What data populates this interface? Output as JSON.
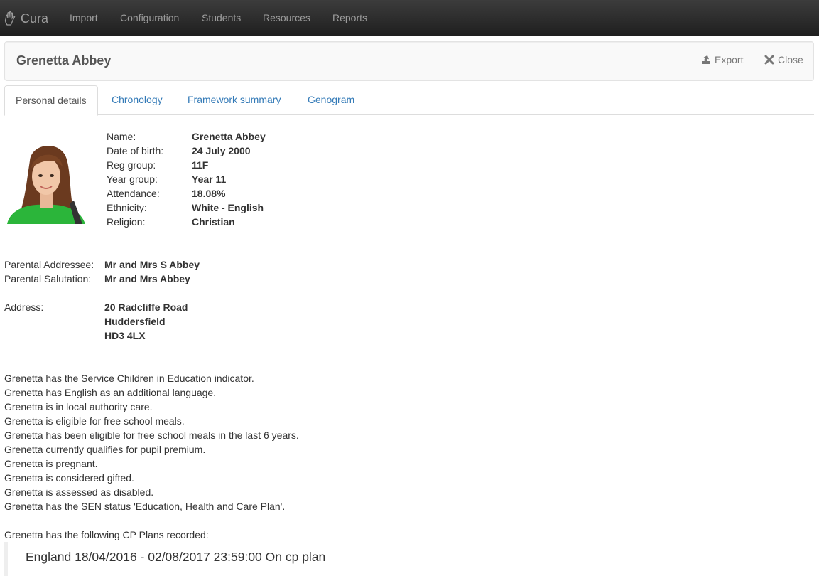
{
  "nav": {
    "brand": "Cura",
    "items": [
      "Import",
      "Configuration",
      "Students",
      "Resources",
      "Reports"
    ]
  },
  "header": {
    "title": "Grenetta Abbey",
    "export_label": "Export",
    "close_label": "Close"
  },
  "tabs": [
    "Personal details",
    "Chronology",
    "Framework summary",
    "Genogram"
  ],
  "details": [
    {
      "label": "Name:",
      "value": "Grenetta Abbey"
    },
    {
      "label": "Date of birth:",
      "value": "24 July 2000"
    },
    {
      "label": "Reg group:",
      "value": "11F"
    },
    {
      "label": "Year group:",
      "value": "Year 11"
    },
    {
      "label": "Attendance:",
      "value": "18.08%"
    },
    {
      "label": "Ethnicity:",
      "value": "White - English"
    },
    {
      "label": "Religion:",
      "value": "Christian"
    }
  ],
  "parental": {
    "addressee_label": "Parental Addressee:",
    "addressee_value": "Mr and Mrs S Abbey",
    "salutation_label": "Parental Salutation:",
    "salutation_value": "Mr and Mrs Abbey"
  },
  "address": {
    "label": "Address:",
    "lines": [
      "20 Radcliffe Road",
      "Huddersfield",
      "HD3 4LX"
    ]
  },
  "indicators": [
    "Grenetta has the Service Children in Education indicator.",
    "Grenetta has English as an additional language.",
    "Grenetta is in local authority care.",
    "Grenetta is eligible for free school meals.",
    "Grenetta has been eligible for free school meals in the last 6 years.",
    "Grenetta currently qualifies for pupil premium.",
    "Grenetta is pregnant.",
    "Grenetta is considered gifted.",
    "Grenetta is assessed as disabled.",
    "Grenetta has the SEN status 'Education, Health and Care Plan'."
  ],
  "cp_intro": "Grenetta has the following CP Plans recorded:",
  "cp_plans": [
    "England 18/04/2016 - 02/08/2017 23:59:00 On cp plan"
  ]
}
